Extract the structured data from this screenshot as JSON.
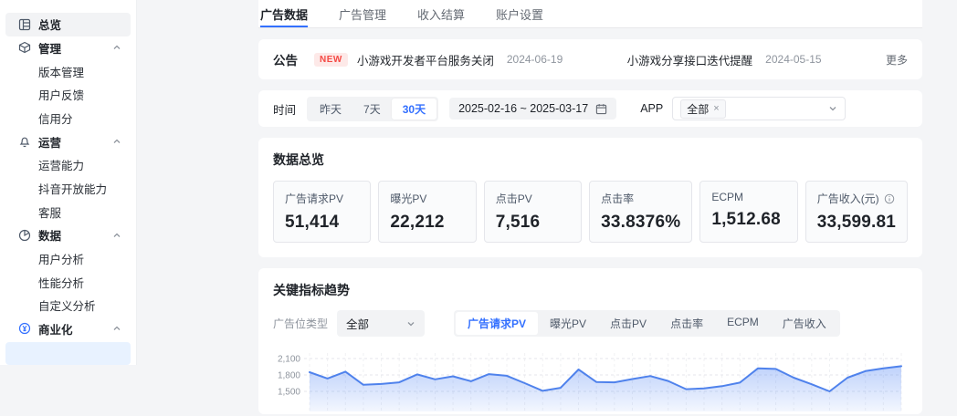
{
  "colors": {
    "accent": "#3370ff",
    "line": "#4f82ec",
    "badge_bg": "#fde9e8",
    "badge_text": "#f54a45",
    "selected_blue_bg": "#e8f2ff"
  },
  "sidebar": {
    "items": [
      {
        "label": "总览",
        "icon": "dashboard-icon"
      },
      {
        "label": "管理",
        "icon": "cube-icon"
      },
      {
        "label": "版本管理"
      },
      {
        "label": "用户反馈"
      },
      {
        "label": "信用分"
      },
      {
        "label": "运营",
        "icon": "bell-icon"
      },
      {
        "label": "运营能力"
      },
      {
        "label": "抖音开放能力"
      },
      {
        "label": "客服"
      },
      {
        "label": "数据",
        "icon": "pie-icon"
      },
      {
        "label": "用户分析"
      },
      {
        "label": "性能分析"
      },
      {
        "label": "自定义分析"
      },
      {
        "label": "商业化",
        "icon": "coin-icon"
      },
      {
        "label": ""
      }
    ]
  },
  "tabs": [
    {
      "label": "广告数据"
    },
    {
      "label": "广告管理"
    },
    {
      "label": "收入结算"
    },
    {
      "label": "账户设置"
    }
  ],
  "announcement": {
    "label": "公告",
    "badge": "NEW",
    "items": [
      {
        "title": "小游戏开发者平台服务关闭",
        "date": "2024-06-19"
      },
      {
        "title": "小游戏分享接口迭代提醒",
        "date": "2024-05-15"
      }
    ],
    "more": "更多"
  },
  "filters": {
    "time_label": "时间",
    "ranges": [
      {
        "label": "昨天"
      },
      {
        "label": "7天"
      },
      {
        "label": "30天"
      }
    ],
    "active_range": "30天",
    "date_range": "2025-02-16 ~ 2025-03-17",
    "app_label": "APP",
    "app_tag": "全部",
    "app_tag_close": "×"
  },
  "overview": {
    "title": "数据总览",
    "metrics": [
      {
        "label": "广告请求PV",
        "value": "51,414"
      },
      {
        "label": "曝光PV",
        "value": "22,212"
      },
      {
        "label": "点击PV",
        "value": "7,516"
      },
      {
        "label": "点击率",
        "value": "33.8376%"
      },
      {
        "label": "ECPM",
        "value": "1,512.68"
      },
      {
        "label": "广告收入(元)",
        "value": "33,599.81",
        "info": true
      }
    ]
  },
  "trend": {
    "title": "关键指标趋势",
    "slot_label": "广告位类型",
    "slot_value": "全部",
    "metric_tabs": [
      {
        "label": "广告请求PV"
      },
      {
        "label": "曝光PV"
      },
      {
        "label": "点击PV"
      },
      {
        "label": "点击率"
      },
      {
        "label": "ECPM"
      },
      {
        "label": "广告收入"
      }
    ],
    "active_metric": "广告请求PV"
  },
  "chart_data": {
    "type": "area",
    "series_name": "广告请求PV",
    "values": [
      1850,
      1735,
      1860,
      1620,
      1635,
      1665,
      1810,
      1720,
      1775,
      1685,
      1815,
      1785,
      1650,
      1510,
      1565,
      1900,
      1670,
      1665,
      1725,
      1780,
      1690,
      1540,
      1555,
      1595,
      1660,
      1920,
      1910,
      1750,
      1630,
      1500,
      1750,
      1870,
      1920,
      1960
    ],
    "x_range": "2025-02-16 ~ 2025-03-17",
    "x_labels_visible": false,
    "y_ticks": [
      "2,100",
      "1,800",
      "1,500"
    ],
    "y_tick_values": [
      2100,
      1800,
      1500
    ],
    "grid": "dashed",
    "line_color": "#4f82ec",
    "area_color": "#5688f5"
  }
}
